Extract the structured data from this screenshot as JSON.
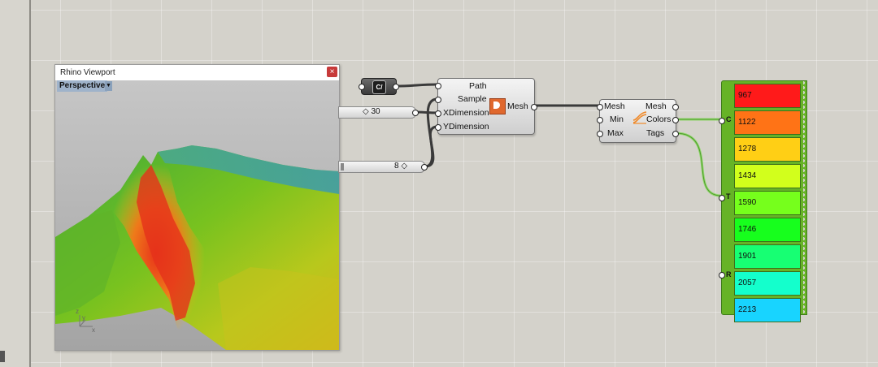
{
  "viewport": {
    "title": "Rhino Viewport",
    "view_name": "Perspective",
    "close_icon": "×",
    "axis_labels": {
      "z": "z",
      "y": "y",
      "x": "x"
    }
  },
  "components": {
    "path_param": {
      "icon_text": "C/"
    },
    "slider_x": {
      "value": "30"
    },
    "slider_y": {
      "value": "8"
    },
    "mesh_from_image": {
      "inputs": [
        "Path",
        "Sample",
        "XDimension",
        "YDimension"
      ],
      "output": "Mesh"
    },
    "gradient": {
      "inputs": [
        "Mesh",
        "Min",
        "Max"
      ],
      "outputs": [
        "Mesh",
        "Colors",
        "Tags"
      ]
    },
    "legend": {
      "ports": [
        "C",
        "T",
        "R"
      ],
      "items": [
        {
          "label": "967",
          "color": "#ff1a1a"
        },
        {
          "label": "1122",
          "color": "#ff7316"
        },
        {
          "label": "1278",
          "color": "#ffcf15"
        },
        {
          "label": "1434",
          "color": "#d2ff1c"
        },
        {
          "label": "1590",
          "color": "#76ff1c"
        },
        {
          "label": "1746",
          "color": "#17ff1d"
        },
        {
          "label": "1901",
          "color": "#17ff73"
        },
        {
          "label": "2057",
          "color": "#14ffcc"
        },
        {
          "label": "2213",
          "color": "#18d4ff"
        }
      ]
    }
  }
}
